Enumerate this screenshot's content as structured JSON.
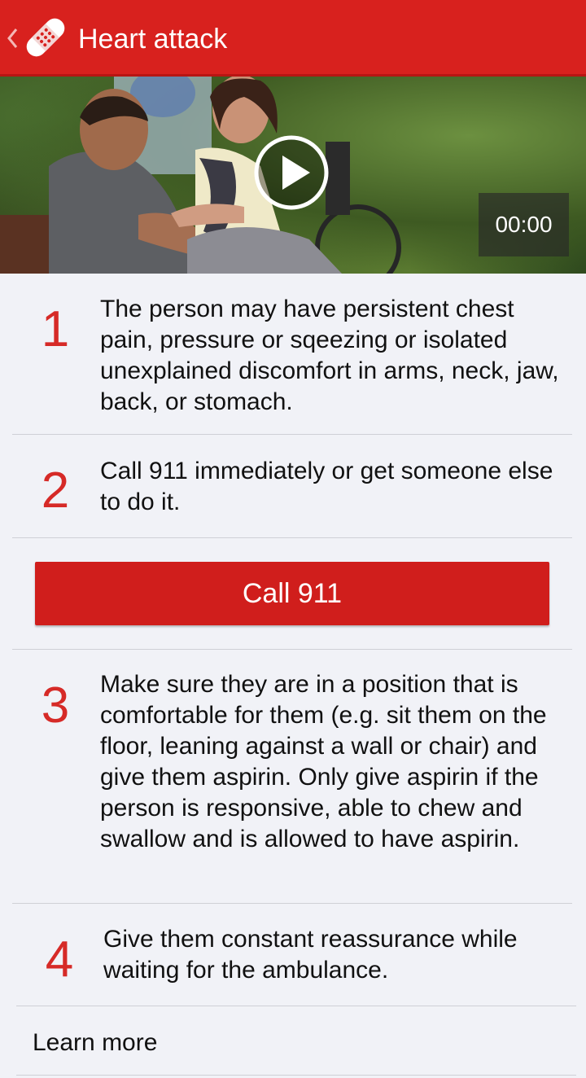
{
  "header": {
    "title": "Heart attack",
    "back_icon": "chevron-left-icon",
    "app_icon": "bandage-icon",
    "color": "#d8211e"
  },
  "video": {
    "time": "00:00",
    "play_icon": "play-icon"
  },
  "steps": [
    {
      "number": "1",
      "text": "The person may have persistent  chest pain, pressure or sqeezing or isolated unexplained discomfort in arms, neck, jaw, back, or stomach."
    },
    {
      "number": "2",
      "text": "Call 911 immediately or get someone else to do it."
    },
    {
      "number": "3",
      "text": "Make sure they are in a position that is comfortable for them (e.g. sit them on the floor, leaning against a wall or chair) and give them aspirin. Only give aspirin if the person is responsive, able to chew and swallow and is allowed to have aspirin."
    },
    {
      "number": "4",
      "text": "Give them constant reassurance while waiting for the ambulance."
    }
  ],
  "call_button": {
    "label": "Call 911",
    "color": "#d01e1c"
  },
  "learn_more": {
    "label": "Learn more"
  },
  "accent_color": "#d62a27"
}
